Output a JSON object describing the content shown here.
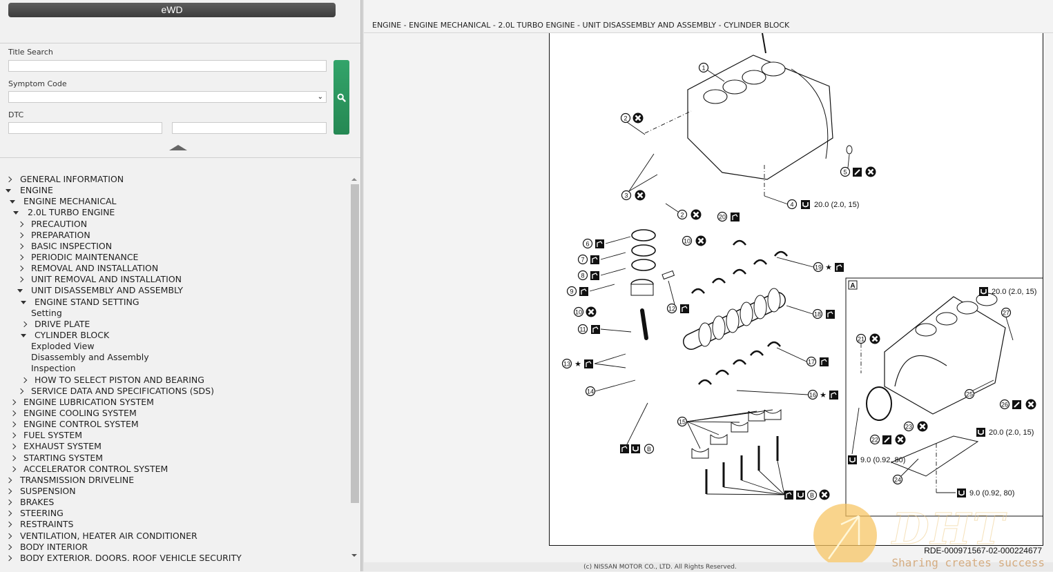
{
  "app": {
    "title": "eWD"
  },
  "search": {
    "title_search_label": "Title Search",
    "title_search_value": "",
    "symptom_code_label": "Symptom Code",
    "symptom_code_value": "",
    "dtc_label": "DTC",
    "dtc_value_1": "",
    "dtc_value_2": "",
    "search_button_icon": "search-icon",
    "collapse_icon": "collapse-up-icon"
  },
  "tree": [
    {
      "label": "GENERAL INFORMATION",
      "level": 0,
      "state": "closed"
    },
    {
      "label": "ENGINE",
      "level": 0,
      "state": "open"
    },
    {
      "label": "ENGINE MECHANICAL",
      "level": 1,
      "state": "open"
    },
    {
      "label": "2.0L TURBO ENGINE",
      "level": 2,
      "state": "open"
    },
    {
      "label": "PRECAUTION",
      "level": 3,
      "state": "closed"
    },
    {
      "label": "PREPARATION",
      "level": 3,
      "state": "closed"
    },
    {
      "label": "BASIC INSPECTION",
      "level": 3,
      "state": "closed"
    },
    {
      "label": "PERIODIC MAINTENANCE",
      "level": 3,
      "state": "closed"
    },
    {
      "label": "REMOVAL AND INSTALLATION",
      "level": 3,
      "state": "closed"
    },
    {
      "label": "UNIT REMOVAL AND INSTALLATION",
      "level": 3,
      "state": "closed"
    },
    {
      "label": "UNIT DISASSEMBLY AND ASSEMBLY",
      "level": 3,
      "state": "open"
    },
    {
      "label": "ENGINE STAND SETTING",
      "level": 4,
      "state": "open"
    },
    {
      "label": "Setting",
      "level": 5,
      "state": "leaf"
    },
    {
      "label": "DRIVE PLATE",
      "level": 4,
      "state": "closed"
    },
    {
      "label": "CYLINDER BLOCK",
      "level": 4,
      "state": "open"
    },
    {
      "label": "Exploded View",
      "level": 5,
      "state": "leaf"
    },
    {
      "label": "Disassembly and Assembly",
      "level": 5,
      "state": "leaf"
    },
    {
      "label": "Inspection",
      "level": 5,
      "state": "leaf"
    },
    {
      "label": "HOW TO SELECT PISTON AND BEARING",
      "level": 4,
      "state": "closed"
    },
    {
      "label": "SERVICE DATA AND SPECIFICATIONS (SDS)",
      "level": 3,
      "state": "closed"
    },
    {
      "label": "ENGINE LUBRICATION SYSTEM",
      "level": 1,
      "state": "closed"
    },
    {
      "label": "ENGINE COOLING SYSTEM",
      "level": 1,
      "state": "closed"
    },
    {
      "label": "ENGINE CONTROL SYSTEM",
      "level": 1,
      "state": "closed"
    },
    {
      "label": "FUEL SYSTEM",
      "level": 1,
      "state": "closed"
    },
    {
      "label": "EXHAUST SYSTEM",
      "level": 1,
      "state": "closed"
    },
    {
      "label": "STARTING SYSTEM",
      "level": 1,
      "state": "closed"
    },
    {
      "label": "ACCELERATOR CONTROL SYSTEM",
      "level": 1,
      "state": "closed"
    },
    {
      "label": "TRANSMISSION DRIVELINE",
      "level": 0,
      "state": "closed"
    },
    {
      "label": "SUSPENSION",
      "level": 0,
      "state": "closed"
    },
    {
      "label": "BRAKES",
      "level": 0,
      "state": "closed"
    },
    {
      "label": "STEERING",
      "level": 0,
      "state": "closed"
    },
    {
      "label": "RESTRAINTS",
      "level": 0,
      "state": "closed"
    },
    {
      "label": "VENTILATION, HEATER AIR CONDITIONER",
      "level": 0,
      "state": "closed"
    },
    {
      "label": "BODY INTERIOR",
      "level": 0,
      "state": "closed"
    },
    {
      "label": "BODY EXTERIOR. DOORS. ROOF VEHICLE SECURITY",
      "level": 0,
      "state": "closed"
    }
  ],
  "content": {
    "breadcrumb": "ENGINE - ENGINE MECHANICAL - 2.0L TURBO ENGINE - UNIT DISASSEMBLY AND ASSEMBLY - CYLINDER BLOCK",
    "figure_id": "RDE-000971567-02-000224677",
    "copyright": "(c) NISSAN MOTOR CO., LTD. All Rights Reserved.",
    "watermark_logo": "DHT",
    "watermark_text": "Sharing creates success",
    "figure": {
      "callouts": [
        {
          "num": "1",
          "symbols": []
        },
        {
          "num": "2",
          "symbols": [
            "do-not-reuse"
          ]
        },
        {
          "num": "3",
          "symbols": [
            "do-not-reuse"
          ]
        },
        {
          "num": "4",
          "symbols": [
            "torque"
          ],
          "spec": "20.0 (2.0, 15)"
        },
        {
          "num": "5",
          "symbols": [
            "sealant",
            "do-not-reuse"
          ]
        },
        {
          "num": "6",
          "symbols": [
            "oil"
          ]
        },
        {
          "num": "7",
          "symbols": [
            "oil"
          ]
        },
        {
          "num": "8",
          "symbols": [
            "oil"
          ]
        },
        {
          "num": "9",
          "symbols": [
            "oil"
          ]
        },
        {
          "num": "10",
          "symbols": [
            "do-not-reuse"
          ]
        },
        {
          "num": "11",
          "symbols": [
            "oil"
          ]
        },
        {
          "num": "12",
          "symbols": [
            "oil"
          ]
        },
        {
          "num": "13",
          "symbols": [
            "star",
            "oil"
          ]
        },
        {
          "num": "14",
          "symbols": []
        },
        {
          "num": "15",
          "symbols": []
        },
        {
          "num": "16",
          "symbols": [
            "star",
            "oil"
          ]
        },
        {
          "num": "17",
          "symbols": [
            "oil"
          ]
        },
        {
          "num": "18",
          "symbols": [
            "oil"
          ]
        },
        {
          "num": "19",
          "symbols": [
            "star",
            "oil"
          ]
        },
        {
          "num": "20",
          "symbols": [
            "oil"
          ]
        },
        {
          "num": "21",
          "symbols": [
            "do-not-reuse"
          ]
        },
        {
          "num": "22",
          "symbols": [
            "sealant",
            "do-not-reuse"
          ]
        },
        {
          "num": "23",
          "symbols": [
            "do-not-reuse"
          ]
        },
        {
          "num": "24",
          "symbols": []
        },
        {
          "num": "25",
          "symbols": []
        },
        {
          "num": "26",
          "symbols": [
            "sealant",
            "do-not-reuse"
          ]
        },
        {
          "num": "27",
          "symbols": []
        }
      ],
      "detail_label": "A",
      "torque_specs": {
        "t4": "20.0 (2.0, 15)",
        "ta_top": "20.0 (2.0, 15)",
        "ta_mid": "20.0 (2.0, 15)",
        "ta_left": "9.0 (0.92, 80)",
        "ta_bottom": "9.0 (0.92, 80)"
      },
      "letter_b": "B",
      "star": "★"
    }
  }
}
